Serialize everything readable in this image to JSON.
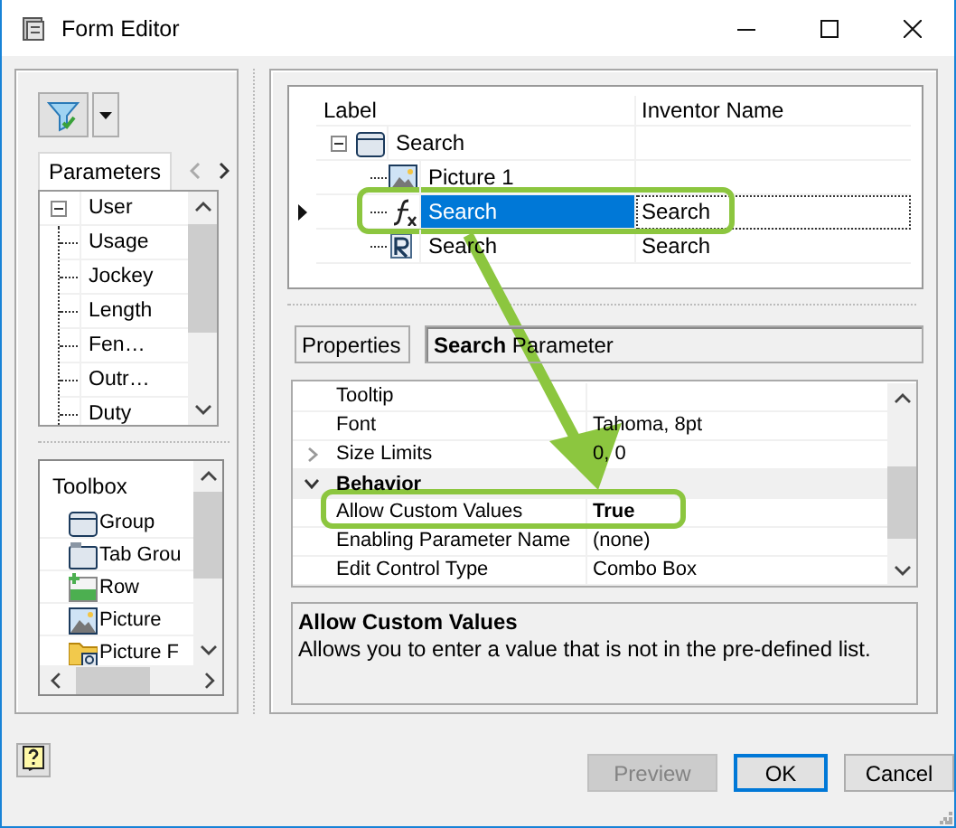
{
  "window": {
    "title": "Form Editor"
  },
  "parameter_tabs": [
    {
      "label": "Parameters",
      "selected": true
    }
  ],
  "parameter_tree": [
    {
      "label": "User",
      "expanded": true,
      "children": [
        {
          "label": "Usage"
        },
        {
          "label": "Jockey"
        },
        {
          "label": "Length"
        },
        {
          "label": "Fen…"
        },
        {
          "label": "Outr…"
        },
        {
          "label": "Duty"
        }
      ]
    }
  ],
  "toolbox": {
    "title": "Toolbox",
    "items": [
      {
        "label": "Group",
        "kind": "group"
      },
      {
        "label": "Tab Grou",
        "kind": "tab-group"
      },
      {
        "label": "Row",
        "kind": "row"
      },
      {
        "label": "Picture",
        "kind": "picture"
      },
      {
        "label": "Picture F",
        "kind": "picture-folder"
      }
    ]
  },
  "form_tree": {
    "columns": [
      "Label",
      "Inventor Name"
    ],
    "rows": [
      {
        "label": "Search",
        "kind": "group",
        "expanded": true,
        "selected": false,
        "children": [
          {
            "label": "Picture 1",
            "kind": "picture",
            "selected": false
          },
          {
            "label": "Search",
            "kind": "parameter",
            "inventor_name": "Search",
            "selected": true
          },
          {
            "label": "Search",
            "kind": "rule",
            "inventor_name": "Search",
            "selected": false
          }
        ]
      }
    ]
  },
  "properties": {
    "tab": "Properties",
    "heading": "**Search** Parameter",
    "rows": [
      {
        "kind": "property",
        "name": "Tooltip"
      },
      {
        "kind": "property",
        "name": "Font",
        "value": "Tahoma, 8pt",
        "modified": false
      },
      {
        "kind": "expandable",
        "name": "Size Limits",
        "value": "0, 0",
        "expanded": false,
        "modified": false
      },
      {
        "kind": "category",
        "name": "Behavior",
        "expanded": true
      },
      {
        "kind": "property",
        "name": "Allow Custom Values",
        "value": "True",
        "modified": true
      },
      {
        "kind": "property",
        "name": "Enabling Parameter Name",
        "value": "(none)",
        "modified": false
      },
      {
        "kind": "property",
        "name": "Edit Control Type",
        "value": "Combo Box",
        "modified": false
      }
    ],
    "description": {
      "title": "Allow Custom Values",
      "text": "Allows you to enter a value that is not in the pre-defined list."
    }
  },
  "buttons": [
    {
      "label": "Preview",
      "disabled": true,
      "default": false
    },
    {
      "label": "OK",
      "disabled": false,
      "default": true
    },
    {
      "label": "Cancel",
      "disabled": false,
      "default": false
    }
  ]
}
